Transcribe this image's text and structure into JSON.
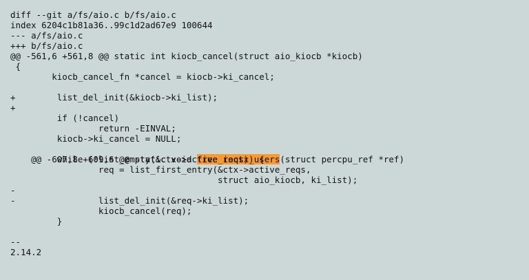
{
  "patch": {
    "header": {
      "diff": "diff --git a/fs/aio.c b/fs/aio.c",
      "index": "index 6204c1b81a36..99c1d2ad67e9 100644",
      "old_file": "--- a/fs/aio.c",
      "new_file": "+++ b/fs/aio.c"
    },
    "hunk1": {
      "header": "@@ -561,6 +561,8 @@ static int kiocb_cancel(struct aio_kiocb *kiocb)",
      "lines": [
        " {",
        "        kiocb_cancel_fn *cancel = kiocb->ki_cancel;",
        "",
        "+        list_del_init(&kiocb->ki_list);",
        "+",
        "         if (!cancel)",
        "                 return -EINVAL;",
        "         kiocb->ki_cancel = NULL;"
      ]
    },
    "hunk2": {
      "header_prefix": "@@ -607,8 +609,6 @@ static void ",
      "header_highlight": "free_ioctx_users",
      "header_suffix": "(struct percpu_ref *ref)",
      "lines": [
        "         while (!list_empty(&ctx->active_reqs)) {",
        "                 req = list_first_entry(&ctx->active_reqs,",
        "                                        struct aio_kiocb, ki_list);",
        "-",
        "-                list_del_init(&req->ki_list);",
        "                 kiocb_cancel(req);",
        "         }"
      ]
    },
    "signature": {
      "separator": "--",
      "version": "2.14.2"
    },
    "colors": {
      "background": "#ccd7d8",
      "highlight": "#f79a34"
    }
  }
}
